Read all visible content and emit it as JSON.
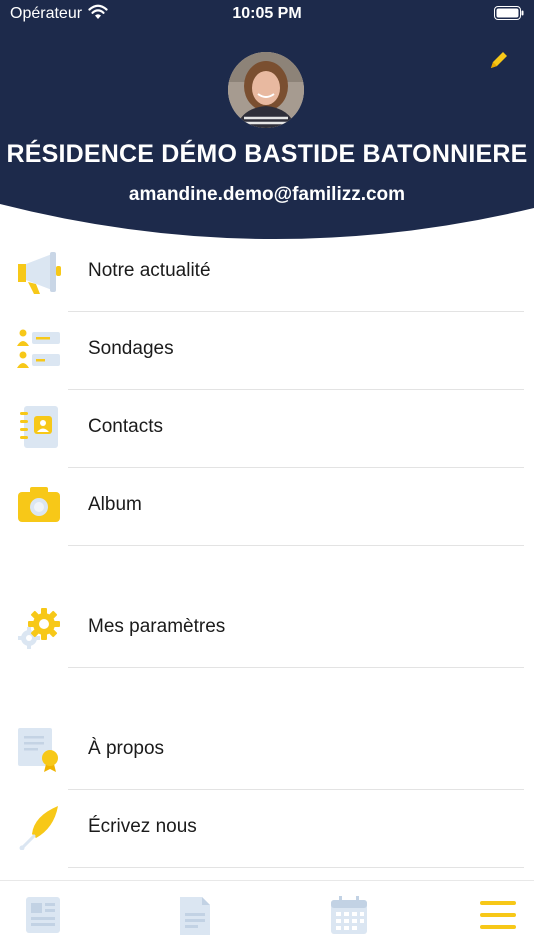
{
  "status_bar": {
    "carrier": "Opérateur",
    "time": "10:05 PM"
  },
  "header": {
    "title": "RÉSIDENCE DÉMO BASTIDE BATONNIERE",
    "email": "amandine.demo@familizz.com",
    "edit_icon": "pencil-icon"
  },
  "menu": {
    "items": [
      {
        "label": "Notre actualité",
        "icon": "megaphone-icon"
      },
      {
        "label": "Sondages",
        "icon": "poll-icon"
      },
      {
        "label": "Contacts",
        "icon": "contact-book-icon"
      },
      {
        "label": "Album",
        "icon": "camera-icon"
      },
      {
        "label": "Mes paramètres",
        "icon": "gear-icon"
      },
      {
        "label": "À propos",
        "icon": "certificate-icon"
      },
      {
        "label": "Écrivez nous",
        "icon": "feather-pen-icon"
      }
    ]
  },
  "tabbar": {
    "tabs": [
      {
        "icon": "newspaper-icon"
      },
      {
        "icon": "document-icon"
      },
      {
        "icon": "calendar-icon"
      },
      {
        "icon": "menu-icon"
      }
    ]
  },
  "colors": {
    "header_bg": "#1d2a4b",
    "accent": "#f7c818",
    "icon_light": "#dbe6f2"
  }
}
